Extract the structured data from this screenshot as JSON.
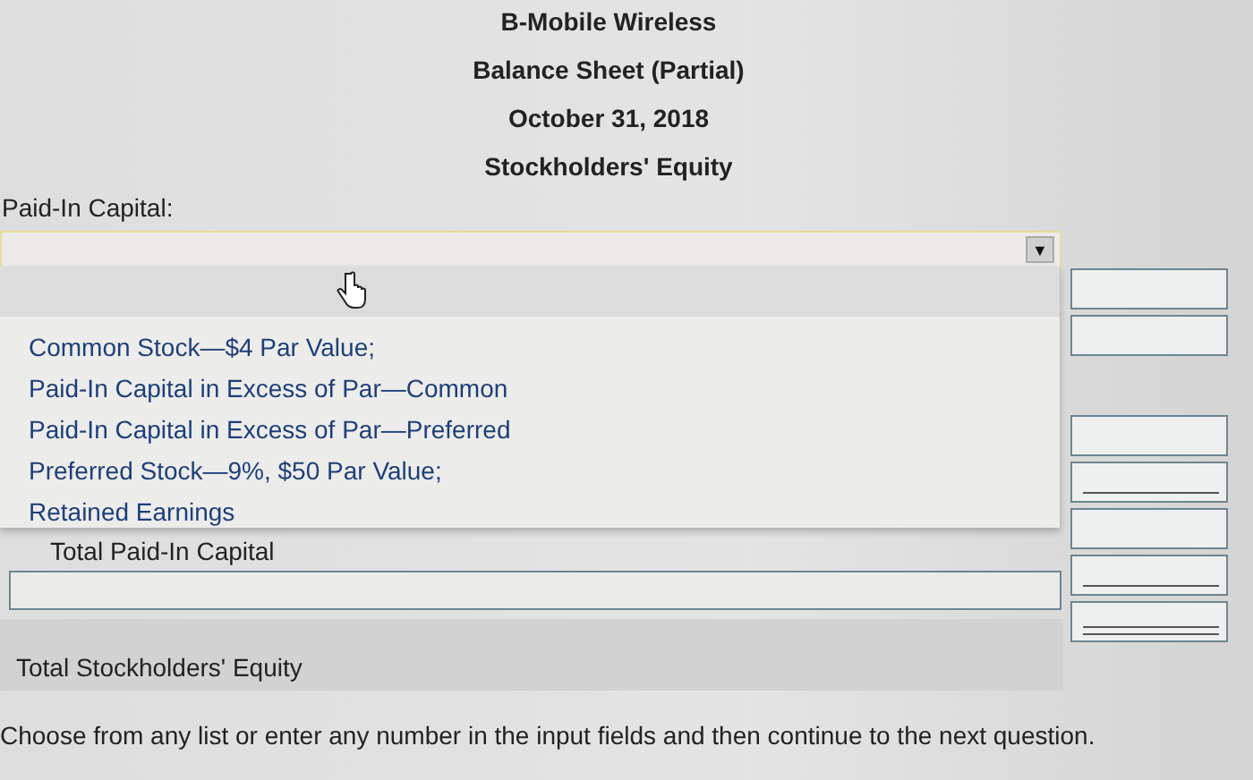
{
  "header": [
    "B-Mobile Wireless",
    "Balance Sheet (Partial)",
    "October 31, 2018",
    "Stockholders' Equity"
  ],
  "paid_in_label": "Paid-In Capital:",
  "dropdown": {
    "expanded": true,
    "arrow": "▼",
    "options": [
      {
        "label": "Common Stock—$4 Par Value;",
        "selected": false
      },
      {
        "label": "Paid-In Capital in Excess of Par—Common",
        "selected": false
      },
      {
        "label": "Paid-In Capital in Excess of Par—Preferred",
        "selected": false
      },
      {
        "label": "Preferred Stock—9%, $50 Par Value;",
        "selected": false
      },
      {
        "label": "Retained Earnings",
        "selected": false
      }
    ]
  },
  "total_paid_in_label": "Total Paid-In Capital",
  "total_equity_label": "Total Stockholders' Equity",
  "amount_fields": [
    {
      "kind": "plain"
    },
    {
      "kind": "plain"
    },
    {
      "kind": "gap"
    },
    {
      "kind": "plain"
    },
    {
      "kind": "single"
    },
    {
      "kind": "plain"
    },
    {
      "kind": "single"
    },
    {
      "kind": "double"
    }
  ],
  "instruction": "Choose from any list or enter any number in the input fields and then continue to the next question."
}
